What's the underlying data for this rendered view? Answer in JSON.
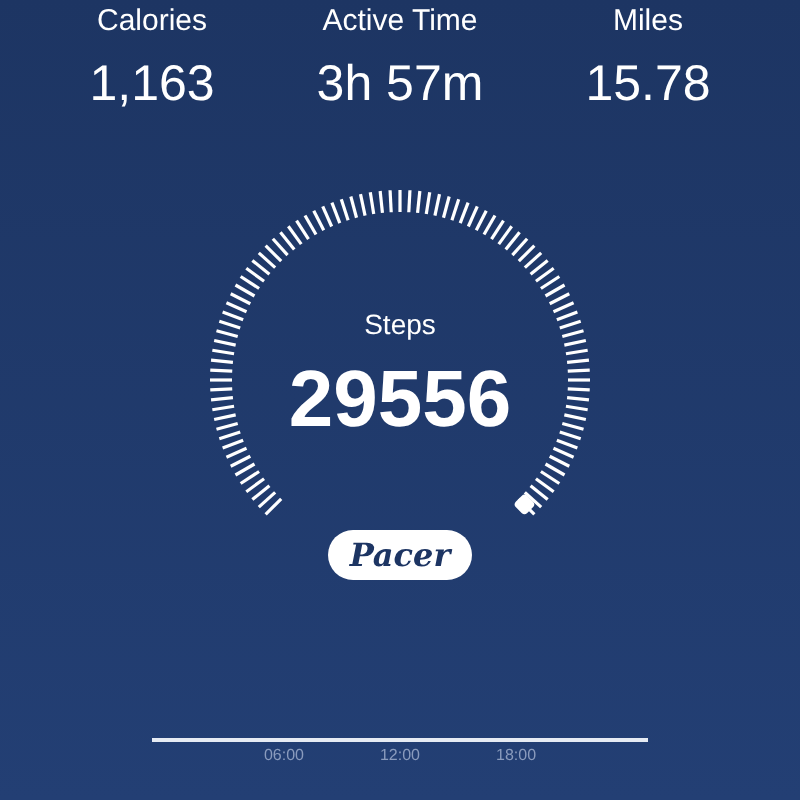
{
  "stats": [
    {
      "label": "Calories",
      "value": "1,163"
    },
    {
      "label": "Active Time",
      "value": "3h 57m"
    },
    {
      "label": "Miles",
      "value": "15.78"
    }
  ],
  "gauge": {
    "label": "Steps",
    "value": "29556"
  },
  "logo": "Pacer",
  "timeline": {
    "ticks": [
      "06:00",
      "12:00",
      "18:00"
    ]
  }
}
